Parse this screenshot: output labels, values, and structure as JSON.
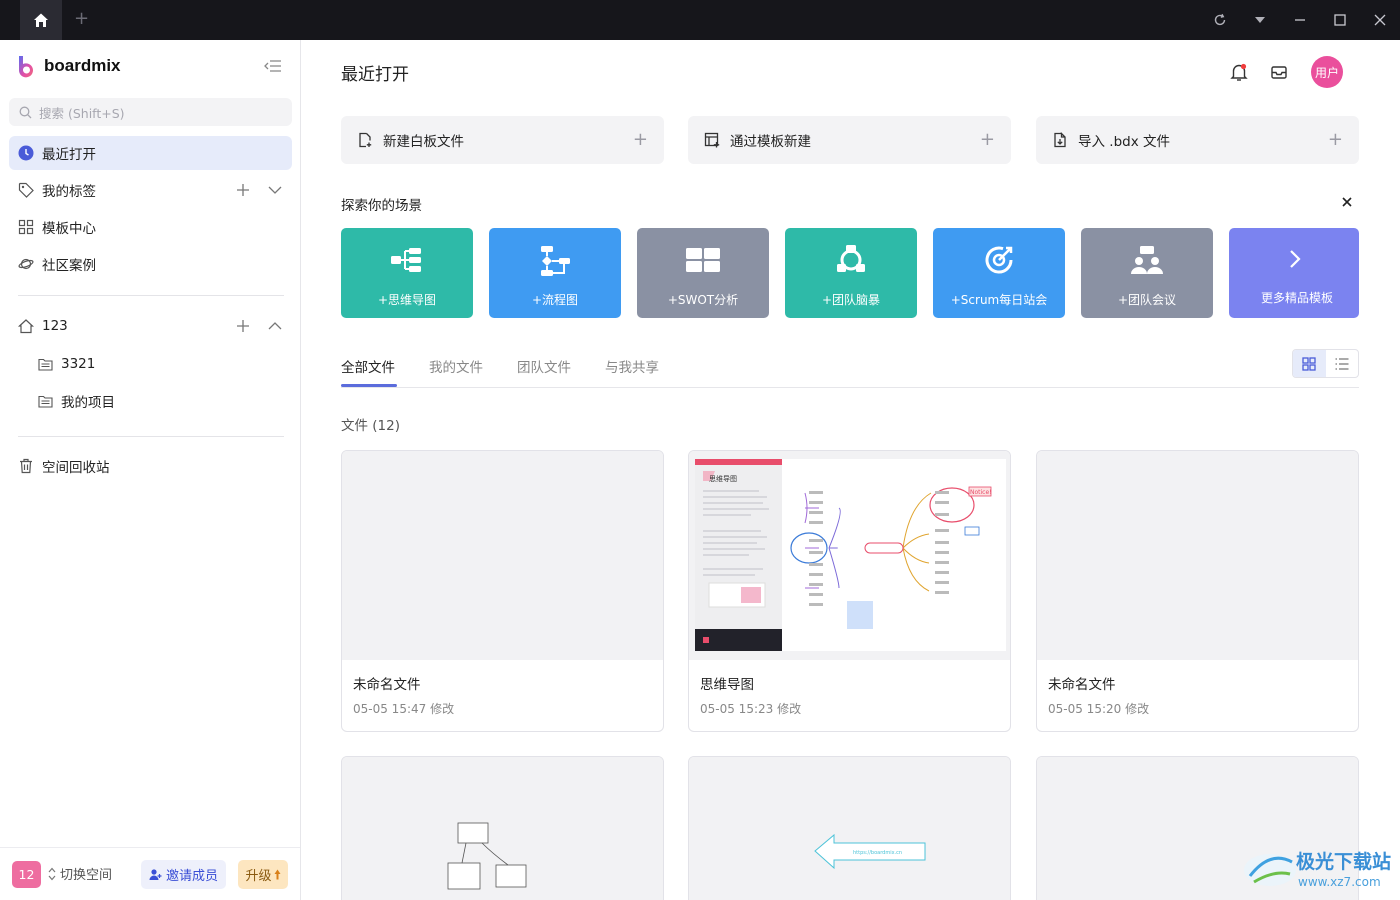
{
  "window": {
    "home_icon": "home-icon",
    "new_tab_label": "+"
  },
  "sidebar": {
    "brand": "boardmix",
    "search_placeholder": "搜索 (Shift+S)",
    "items": [
      {
        "label": "最近打开",
        "icon": "clock-icon"
      },
      {
        "label": "我的标签",
        "icon": "tag-icon"
      },
      {
        "label": "模板中心",
        "icon": "grid-icon"
      },
      {
        "label": "社区案例",
        "icon": "planet-icon"
      }
    ],
    "workspace": {
      "label": "123",
      "folders": [
        "3321",
        "我的项目"
      ]
    },
    "trash": "空间回收站",
    "footer": {
      "space_badge": "12",
      "switch_label": "切换空间",
      "invite_label": "邀请成员",
      "upgrade_label": "升级"
    }
  },
  "header": {
    "title": "最近打开",
    "avatar_label": "用户"
  },
  "actions": [
    {
      "label": "新建白板文件",
      "plus": "+"
    },
    {
      "label": "通过模板新建",
      "plus": "+"
    },
    {
      "label": "导入 .bdx 文件",
      "plus": "+"
    }
  ],
  "explore": {
    "title": "探索你的场景",
    "scenes": [
      {
        "label": "+思维导图",
        "color": "#2ebaa8",
        "icon": "mindmap-icon"
      },
      {
        "label": "+流程图",
        "color": "#3f9bf2",
        "icon": "flowchart-icon"
      },
      {
        "label": "+SWOT分析",
        "color": "#8a91a3",
        "icon": "swot-icon"
      },
      {
        "label": "+团队脑暴",
        "color": "#2ebaa8",
        "icon": "brainstorm-icon"
      },
      {
        "label": "+Scrum每日站会",
        "color": "#3f9bf2",
        "icon": "scrum-icon"
      },
      {
        "label": "+团队会议",
        "color": "#8a91a3",
        "icon": "meeting-icon"
      },
      {
        "label": "更多精品模板",
        "color": "#7b83f0",
        "icon": "chevron-right-icon"
      }
    ]
  },
  "tabs": [
    "全部文件",
    "我的文件",
    "团队文件",
    "与我共享"
  ],
  "files": {
    "count_label": "文件 (12)",
    "items": [
      {
        "name": "未命名文件",
        "meta": "05-05 15:47 修改"
      },
      {
        "name": "思维导图",
        "meta": "05-05 15:23 修改",
        "thumb_title": "思维导图",
        "thumb_notice": "Notice!"
      },
      {
        "name": "未命名文件",
        "meta": "05-05 15:20 修改"
      },
      {
        "name": "",
        "meta": ""
      },
      {
        "name": "",
        "meta": "",
        "thumb_link": "https://boardmix.cn"
      },
      {
        "name": "",
        "meta": ""
      }
    ]
  },
  "watermark": "极光下载站",
  "watermark_url": "www.xz7.com"
}
